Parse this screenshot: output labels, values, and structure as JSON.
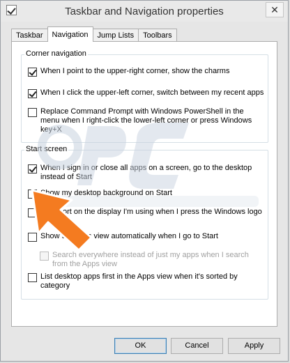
{
  "window": {
    "title": "Taskbar and Navigation properties",
    "close_glyph": "✕"
  },
  "tabs": [
    {
      "label": "Taskbar",
      "active": false
    },
    {
      "label": "Navigation",
      "active": true
    },
    {
      "label": "Jump Lists",
      "active": false
    },
    {
      "label": "Toolbars",
      "active": false
    }
  ],
  "corner_navigation": {
    "label": "Corner navigation",
    "options": [
      {
        "text": "When I point to the upper-right corner, show the charms",
        "checked": true
      },
      {
        "text": "When I click the upper-left corner, switch between my recent apps",
        "checked": true
      },
      {
        "text": "Replace Command Prompt with Windows PowerShell in the menu when I right-click the lower-left corner or press Windows key+X",
        "checked": false
      }
    ]
  },
  "start_screen": {
    "label": "Start screen",
    "options": [
      {
        "text": "When I sign in or close all apps on a screen, go to the desktop instead of Start",
        "checked": true
      },
      {
        "text": "Show my desktop background on Start",
        "checked": false
      },
      {
        "text": "ort on the display I'm using when I press the Windows logo",
        "checked": false
      },
      {
        "text": "Show the Apps view automatically when I go to Start",
        "checked": false
      },
      {
        "text": "Search everywhere instead of just my apps when I search from the Apps view",
        "checked": false,
        "disabled": true
      },
      {
        "text": "List desktop apps first in the Apps view when it's sorted by category",
        "checked": false
      }
    ]
  },
  "buttons": {
    "ok": "OK",
    "cancel": "Cancel",
    "apply": "Apply"
  },
  "colors": {
    "arrow": "#f47b20",
    "watermark": "#c7d2df"
  },
  "icons": {
    "app": "checkbox-app-icon",
    "close": "close-icon"
  }
}
